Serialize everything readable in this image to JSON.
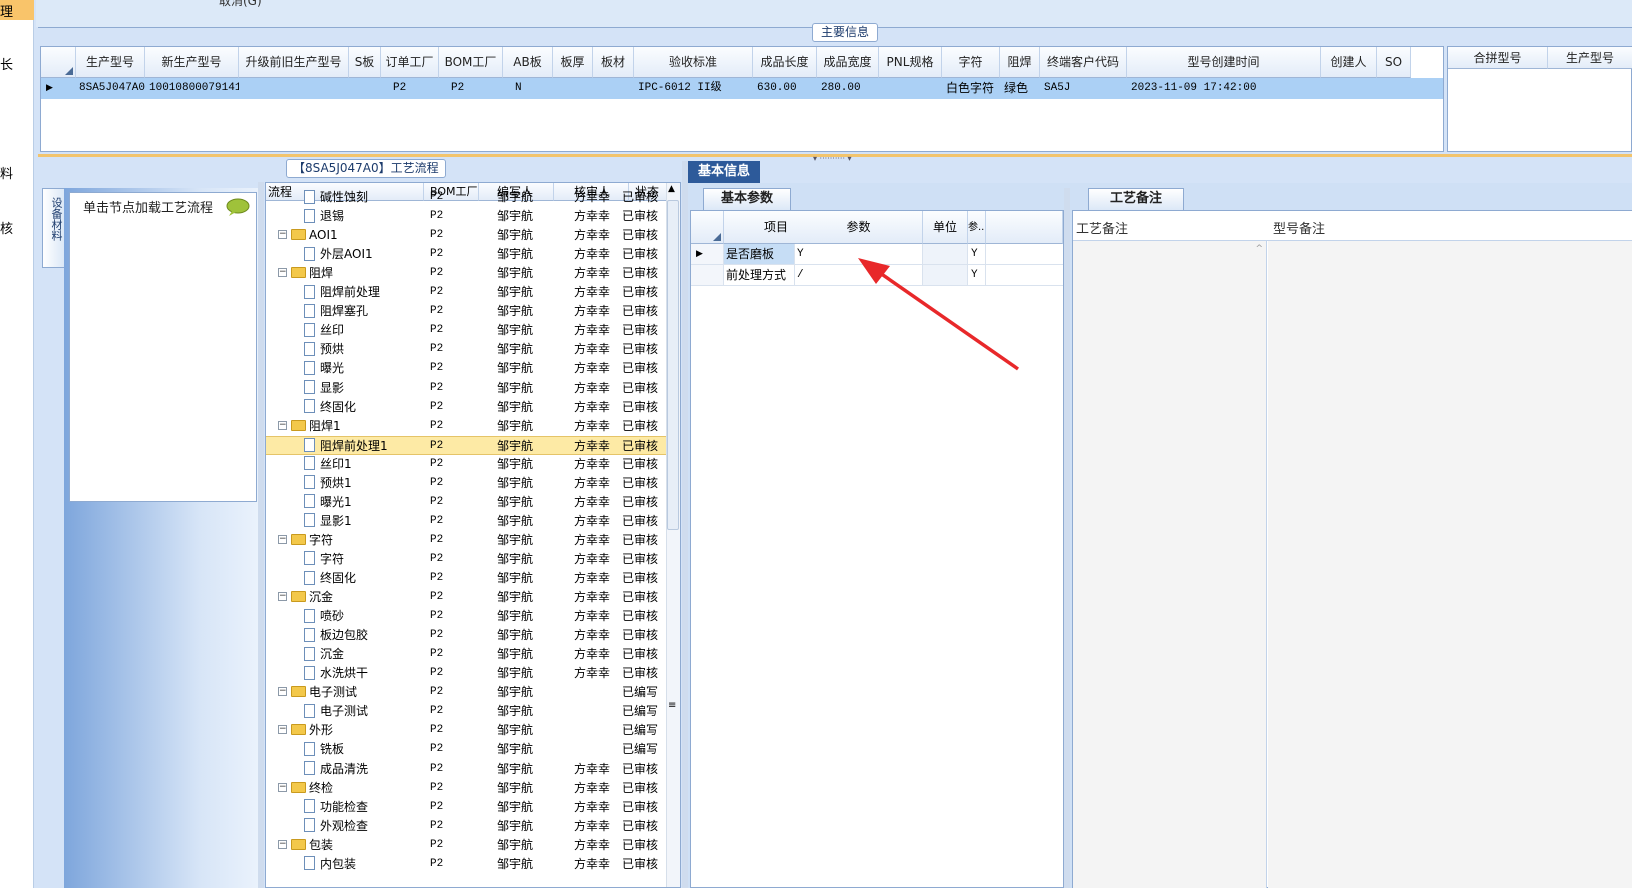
{
  "left_strip": {
    "items": [
      "理",
      "长",
      "料",
      "核"
    ]
  },
  "top": {
    "cut_text": "取消(G)"
  },
  "main_info": {
    "title": "主要信息",
    "columns": [
      "生产型号",
      "新生产型号",
      "升级前旧生产型号",
      "S板",
      "订单工厂",
      "BOM工厂",
      "AB板",
      "板厚",
      "板材",
      "验收标准",
      "成品长度",
      "成品宽度",
      "PNL规格",
      "字符",
      "阻焊",
      "终端客户代码",
      "型号创建时间",
      "创建人",
      "SO"
    ],
    "row": {
      "生产型号": "8SA5J047A0",
      "新生产型号": "10010800079141",
      "升级前旧生产型号": "",
      "S板": "",
      "订单工厂": "P2",
      "BOM工厂": "P2",
      "AB板": "N",
      "板厚": "",
      "板材": "",
      "验收标准": "IPC-6012 II级",
      "成品长度": "630.00",
      "成品宽度": "280.00",
      "PNL规格": "",
      "字符": "白色字符",
      "阻焊": "绿色",
      "终端客户代码": "SA5J",
      "型号创建时间": "2023-11-09 17:42:00",
      "创建人": "",
      "SO": ""
    },
    "side_columns": [
      "合拼型号",
      "生产型号"
    ]
  },
  "flow": {
    "title": "【8SA5J047A0】工艺流程",
    "vtab": "设备材料",
    "hint": "单击节点加载工艺流程",
    "columns": [
      "流程",
      "BOM工厂",
      "编写人",
      "核审人",
      "状态"
    ],
    "rows": [
      {
        "type": "doc",
        "name": "碱性蚀刻",
        "bom": "P2",
        "writer": "邹宇航",
        "reviewer": "方幸幸",
        "status": "已审核"
      },
      {
        "type": "doc",
        "name": "退锡",
        "bom": "P2",
        "writer": "邹宇航",
        "reviewer": "方幸幸",
        "status": "已审核"
      },
      {
        "type": "folder",
        "name": "AOI1",
        "bom": "P2",
        "writer": "邹宇航",
        "reviewer": "方幸幸",
        "status": "已审核"
      },
      {
        "type": "doc",
        "name": "外层AOI1",
        "bom": "P2",
        "writer": "邹宇航",
        "reviewer": "方幸幸",
        "status": "已审核"
      },
      {
        "type": "folder",
        "name": "阻焊",
        "bom": "P2",
        "writer": "邹宇航",
        "reviewer": "方幸幸",
        "status": "已审核"
      },
      {
        "type": "doc",
        "name": "阻焊前处理",
        "bom": "P2",
        "writer": "邹宇航",
        "reviewer": "方幸幸",
        "status": "已审核"
      },
      {
        "type": "doc",
        "name": "阻焊塞孔",
        "bom": "P2",
        "writer": "邹宇航",
        "reviewer": "方幸幸",
        "status": "已审核"
      },
      {
        "type": "doc",
        "name": "丝印",
        "bom": "P2",
        "writer": "邹宇航",
        "reviewer": "方幸幸",
        "status": "已审核"
      },
      {
        "type": "doc",
        "name": "预烘",
        "bom": "P2",
        "writer": "邹宇航",
        "reviewer": "方幸幸",
        "status": "已审核"
      },
      {
        "type": "doc",
        "name": "曝光",
        "bom": "P2",
        "writer": "邹宇航",
        "reviewer": "方幸幸",
        "status": "已审核"
      },
      {
        "type": "doc",
        "name": "显影",
        "bom": "P2",
        "writer": "邹宇航",
        "reviewer": "方幸幸",
        "status": "已审核"
      },
      {
        "type": "doc",
        "name": "终固化",
        "bom": "P2",
        "writer": "邹宇航",
        "reviewer": "方幸幸",
        "status": "已审核"
      },
      {
        "type": "folder",
        "name": "阻焊1",
        "bom": "P2",
        "writer": "邹宇航",
        "reviewer": "方幸幸",
        "status": "已审核"
      },
      {
        "type": "doc",
        "name": "阻焊前处理1",
        "bom": "P2",
        "writer": "邹宇航",
        "reviewer": "方幸幸",
        "status": "已审核",
        "selected": true
      },
      {
        "type": "doc",
        "name": "丝印1",
        "bom": "P2",
        "writer": "邹宇航",
        "reviewer": "方幸幸",
        "status": "已审核"
      },
      {
        "type": "doc",
        "name": "预烘1",
        "bom": "P2",
        "writer": "邹宇航",
        "reviewer": "方幸幸",
        "status": "已审核"
      },
      {
        "type": "doc",
        "name": "曝光1",
        "bom": "P2",
        "writer": "邹宇航",
        "reviewer": "方幸幸",
        "status": "已审核"
      },
      {
        "type": "doc",
        "name": "显影1",
        "bom": "P2",
        "writer": "邹宇航",
        "reviewer": "方幸幸",
        "status": "已审核"
      },
      {
        "type": "folder",
        "name": "字符",
        "bom": "P2",
        "writer": "邹宇航",
        "reviewer": "方幸幸",
        "status": "已审核"
      },
      {
        "type": "doc",
        "name": "字符",
        "bom": "P2",
        "writer": "邹宇航",
        "reviewer": "方幸幸",
        "status": "已审核"
      },
      {
        "type": "doc",
        "name": "终固化",
        "bom": "P2",
        "writer": "邹宇航",
        "reviewer": "方幸幸",
        "status": "已审核"
      },
      {
        "type": "folder",
        "name": "沉金",
        "bom": "P2",
        "writer": "邹宇航",
        "reviewer": "方幸幸",
        "status": "已审核"
      },
      {
        "type": "doc",
        "name": "喷砂",
        "bom": "P2",
        "writer": "邹宇航",
        "reviewer": "方幸幸",
        "status": "已审核"
      },
      {
        "type": "doc",
        "name": "板边包胶",
        "bom": "P2",
        "writer": "邹宇航",
        "reviewer": "方幸幸",
        "status": "已审核"
      },
      {
        "type": "doc",
        "name": "沉金",
        "bom": "P2",
        "writer": "邹宇航",
        "reviewer": "方幸幸",
        "status": "已审核"
      },
      {
        "type": "doc",
        "name": "水洗烘干",
        "bom": "P2",
        "writer": "邹宇航",
        "reviewer": "方幸幸",
        "status": "已审核"
      },
      {
        "type": "folder",
        "name": "电子测试",
        "bom": "P2",
        "writer": "邹宇航",
        "reviewer": "",
        "status": "已编写"
      },
      {
        "type": "doc",
        "name": "电子测试",
        "bom": "P2",
        "writer": "邹宇航",
        "reviewer": "",
        "status": "已编写"
      },
      {
        "type": "folder",
        "name": "外形",
        "bom": "P2",
        "writer": "邹宇航",
        "reviewer": "",
        "status": "已编写"
      },
      {
        "type": "doc",
        "name": "铣板",
        "bom": "P2",
        "writer": "邹宇航",
        "reviewer": "",
        "status": "已编写"
      },
      {
        "type": "doc",
        "name": "成品清洗",
        "bom": "P2",
        "writer": "邹宇航",
        "reviewer": "方幸幸",
        "status": "已审核"
      },
      {
        "type": "folder",
        "name": "终检",
        "bom": "P2",
        "writer": "邹宇航",
        "reviewer": "方幸幸",
        "status": "已审核"
      },
      {
        "type": "doc",
        "name": "功能检查",
        "bom": "P2",
        "writer": "邹宇航",
        "reviewer": "方幸幸",
        "status": "已审核"
      },
      {
        "type": "doc",
        "name": "外观检查",
        "bom": "P2",
        "writer": "邹宇航",
        "reviewer": "方幸幸",
        "status": "已审核"
      },
      {
        "type": "folder",
        "name": "包装",
        "bom": "P2",
        "writer": "邹宇航",
        "reviewer": "方幸幸",
        "status": "已审核"
      },
      {
        "type": "doc",
        "name": "内包装",
        "bom": "P2",
        "writer": "邹宇航",
        "reviewer": "方幸幸",
        "status": "已审核"
      }
    ]
  },
  "basic_info": {
    "tab": "基本信息",
    "params_tab": "基本参数",
    "columns": [
      "项目",
      "参数",
      "单位",
      "参..."
    ],
    "rows": [
      {
        "item": "是否磨板",
        "param": "Y",
        "unit": "",
        "extra": "Y"
      },
      {
        "item": "前处理方式",
        "param": "/",
        "unit": "",
        "extra": "Y"
      }
    ]
  },
  "remarks": {
    "tab": "工艺备注",
    "col1": "工艺备注",
    "col2": "型号备注"
  },
  "colors": {
    "accent": "#2d5a9a",
    "selection": "#fdeaa5",
    "row_highlight": "#abd0f5",
    "arrow": "#e8282a"
  }
}
